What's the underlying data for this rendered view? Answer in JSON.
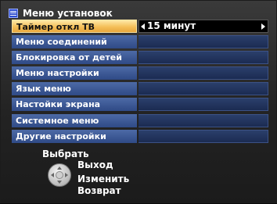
{
  "header": {
    "title": "Меню установок",
    "icon": "menu-list-icon"
  },
  "menu": {
    "items": [
      {
        "label": "Таймер откл ТВ",
        "value": "15 минут",
        "selected": true
      },
      {
        "label": "Меню соединений",
        "value": ""
      },
      {
        "label": "Блокировка от детей",
        "value": ""
      },
      {
        "label": "Меню настройки",
        "value": ""
      },
      {
        "label": "Язык меню",
        "value": ""
      },
      {
        "label": "Настойки экрана",
        "value": ""
      },
      {
        "label": "Системное меню",
        "value": ""
      },
      {
        "label": "Другие настройки",
        "value": ""
      }
    ]
  },
  "footer": {
    "select_label": "Выбрать",
    "exit_label": "Выход",
    "change_label": "Изменить",
    "back_label": "Возврат",
    "dpad_icon": "dpad-icon"
  }
}
